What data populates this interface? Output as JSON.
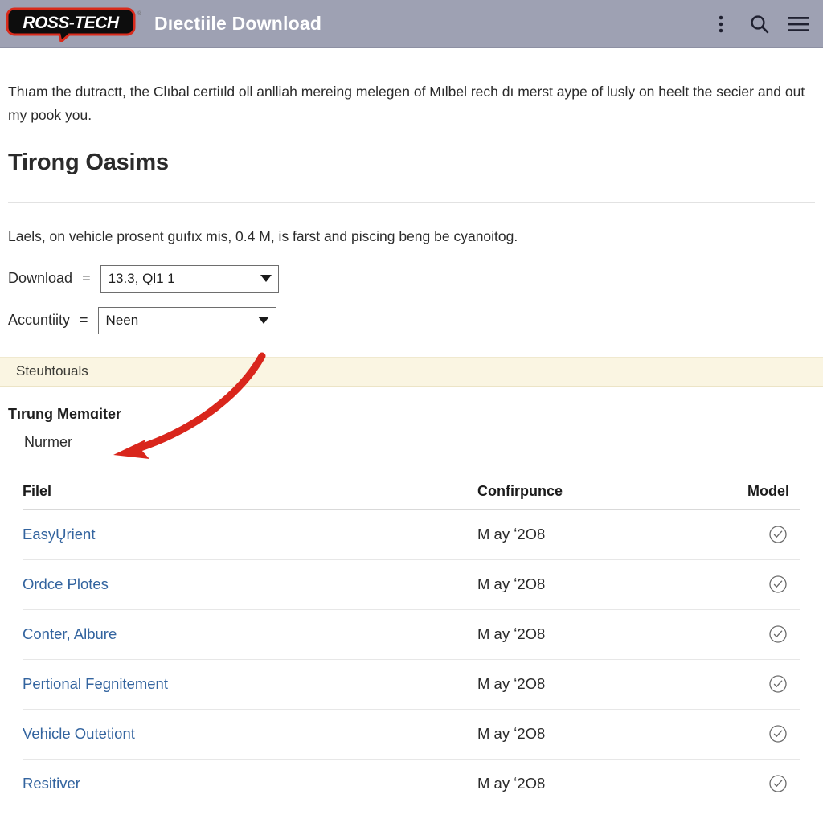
{
  "appbar": {
    "logo_text": "ROSS-TECH",
    "logo_trademark": "®",
    "title": "Dıectiile Download",
    "actions": [
      {
        "name": "overflow-menu-icon",
        "label": "more-vertical-icon"
      },
      {
        "name": "search-icon",
        "label": "search-icon"
      },
      {
        "name": "hamburger-menu-icon",
        "label": "menu-icon"
      }
    ],
    "colors": {
      "bar": "#9ea1b3",
      "title": "#ffffff",
      "logo_outline": "#d92b1c"
    }
  },
  "body": {
    "intro": "Thıam the dutractt, the Clıbal certiıld oll anlliah mereing melegen of Mılbel rech dı merst aype of lusly on heelt the secier and out my pook you.",
    "section_title": "Tirong Oasims",
    "lede": "Laels, on vehicle prosent guıfıx mis, 0.4 M, is farst and piscing beng be cyanoitog."
  },
  "fields": [
    {
      "label": "Download",
      "equals": "=",
      "value": "13.3, Ql1 1"
    },
    {
      "label": "Accuntiity",
      "equals": "=",
      "value": "Neen"
    }
  ],
  "notice": {
    "text": "Steuhtouals",
    "background": "#faf5e2"
  },
  "subsections": {
    "heading": "Tırung Memɑiter",
    "subheading": "Nurmer"
  },
  "table": {
    "columns": [
      "Filel",
      "Confirpunce",
      "Model"
    ],
    "rows": [
      {
        "file": "EasyŲrient",
        "confirpunce": "M ay ʻ2O8",
        "model": "check-circle-icon"
      },
      {
        "file": "Ordce Plotes",
        "confirpunce": "M ay ʻ2O8",
        "model": "check-circle-icon"
      },
      {
        "file": "Conter, Albure",
        "confirpunce": "M ay ʻ2O8",
        "model": "check-circle-icon"
      },
      {
        "file": "Pertional Fegnitement",
        "confirpunce": "M ay ʻ2O8",
        "model": "check-circle-icon"
      },
      {
        "file": "Vehicle Outetiont",
        "confirpunce": "M ay ʻ2O8",
        "model": "check-circle-icon"
      },
      {
        "file": "Resitiver",
        "confirpunce": "M ay ʻ2O8",
        "model": "check-circle-icon"
      }
    ],
    "link_color": "#33649f"
  },
  "annotation": {
    "name": "red-curved-arrow",
    "color": "#d9261c"
  }
}
